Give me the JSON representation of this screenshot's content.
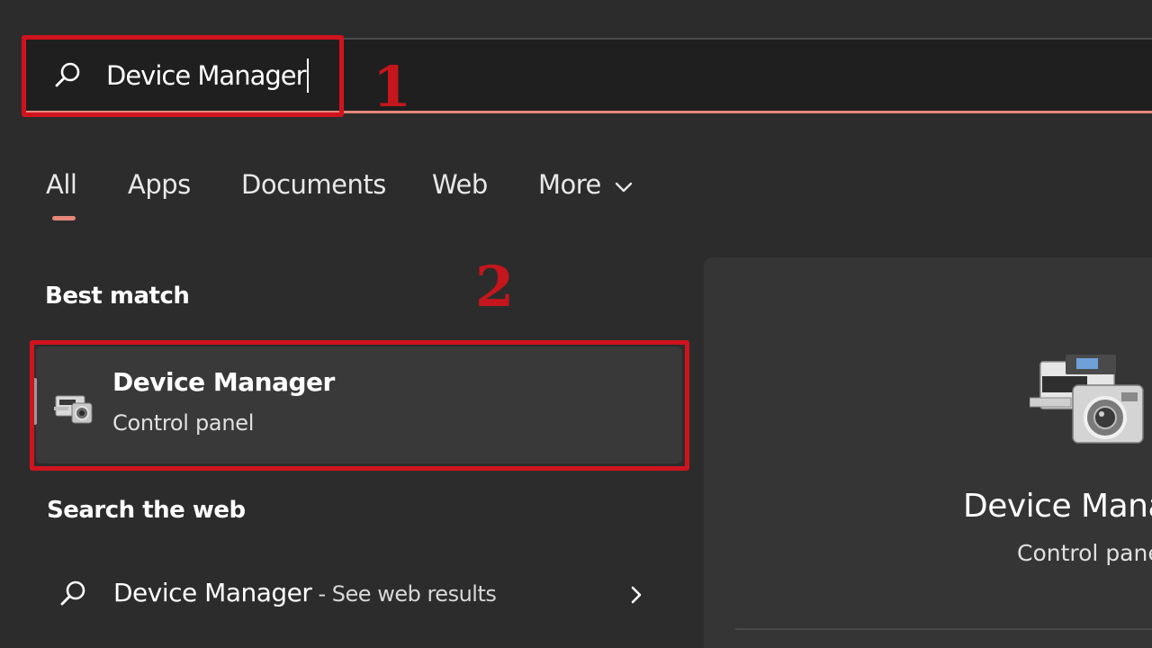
{
  "search": {
    "value": "Device Manager",
    "placeholder": ""
  },
  "annotations": {
    "step1": "1",
    "step2": "2"
  },
  "tabs": [
    {
      "label": "All",
      "active": true
    },
    {
      "label": "Apps"
    },
    {
      "label": "Documents"
    },
    {
      "label": "Web"
    },
    {
      "label": "More"
    }
  ],
  "best_match": {
    "heading": "Best match",
    "title": "Device Manager",
    "subtitle": "Control panel",
    "icon": "device-manager-icon"
  },
  "web": {
    "heading": "Search the web",
    "query": "Device Manager",
    "suffix": " - See web results"
  },
  "preview": {
    "title": "Device Mana",
    "subtitle": "Control pane"
  },
  "colors": {
    "accent": "#e5877b",
    "highlight": "#d0141e",
    "background": "#2c2c2c"
  }
}
